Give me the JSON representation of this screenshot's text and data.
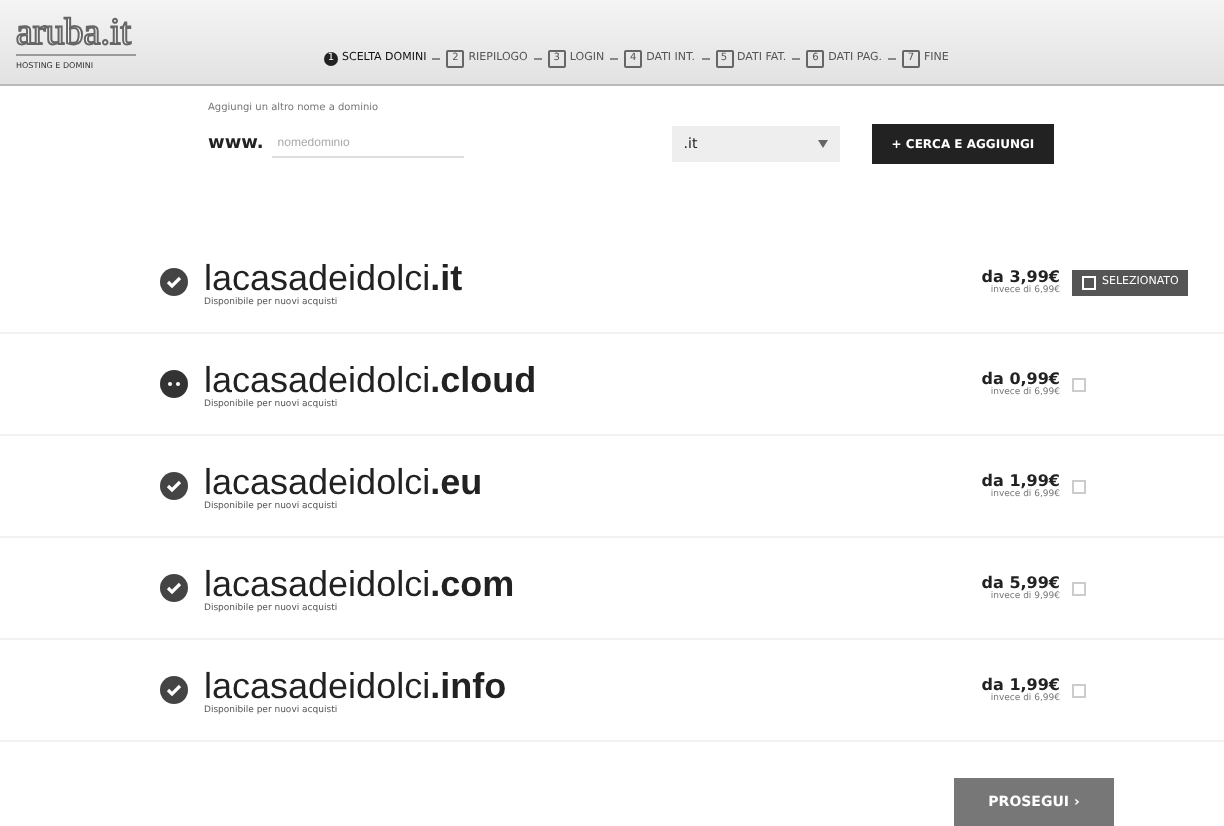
{
  "header": {
    "logo": "aruba.it",
    "tagline": "HOSTING E DOMINI",
    "steps": [
      {
        "number": "1",
        "label": "SCELTA DOMINI",
        "selected": true
      },
      {
        "number": "2",
        "label": "RIEPILOGO",
        "selected": false
      },
      {
        "number": "3",
        "label": "LOGIN",
        "selected": false
      },
      {
        "number": "4",
        "label": "DATI INT.",
        "selected": false
      },
      {
        "number": "5",
        "label": "DATI FAT.",
        "selected": false
      },
      {
        "number": "6",
        "label": "DATI PAG.",
        "selected": false
      },
      {
        "number": "7",
        "label": "FINE",
        "selected": false
      }
    ]
  },
  "search": {
    "hint": "Aggiungi un altro nome a dominio",
    "prefix": "www.",
    "placeholder": "nomedominio",
    "extension": ".it",
    "button": "+ CERCA E AGGIUNGI"
  },
  "domains": [
    {
      "name": "lacasadeidolci**.it**",
      "note": "Disponibile per nuovi acquisti",
      "price": "da 3,99€",
      "price_note": "invece di 6,99€",
      "kind": "available",
      "selected": true,
      "selected_label": "SELEZIONATO"
    },
    {
      "name": "lacasadeidolci**.cloud**",
      "note": "Disponibile per nuovi acquisti",
      "price": "da 0,99€",
      "price_note": "invece di 6,99€",
      "kind": "pending",
      "selected": false
    },
    {
      "name": "lacasadeidolci**.eu**",
      "note": "Disponibile per nuovi acquisti",
      "price": "da 1,99€",
      "price_note": "invece di 6,99€",
      "kind": "available",
      "selected": false
    },
    {
      "name": "lacasadeidolci**.com**",
      "note": "Disponibile per nuovi acquisti",
      "price": "da 5,99€",
      "price_note": "invece di 9,99€",
      "kind": "available",
      "selected": false
    },
    {
      "name": "lacasadeidolci**.info**",
      "note": "Disponibile per nuovi acquisti",
      "price": "da 1,99€",
      "price_note": "invece di 6,99€",
      "kind": "available",
      "selected": false
    }
  ],
  "continue_button": "PROSEGUI ›"
}
